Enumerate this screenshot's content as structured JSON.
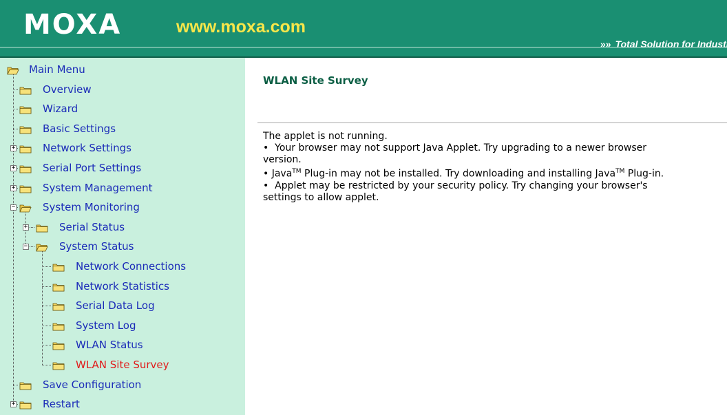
{
  "header": {
    "logo_text": "MOXA",
    "url_text": "www.moxa.com",
    "tagline": "Total Solution for Industrial Device Networking",
    "tagline_arrows": "»»",
    "colors": {
      "bar": "#1a8f72",
      "logo": "#ffffff",
      "url": "#f7e64a"
    }
  },
  "sidebar": {
    "root": {
      "label": "Main Menu",
      "icon": "open-folder-icon"
    },
    "items": [
      {
        "label": "Overview",
        "icon": "folder-icon"
      },
      {
        "label": "Wizard",
        "icon": "folder-icon"
      },
      {
        "label": "Basic Settings",
        "icon": "folder-icon"
      },
      {
        "label": "Network Settings",
        "icon": "folder-icon",
        "expander": "+"
      },
      {
        "label": "Serial Port Settings",
        "icon": "folder-icon",
        "expander": "+"
      },
      {
        "label": "System Management",
        "icon": "folder-icon",
        "expander": "+"
      },
      {
        "label": "System Monitoring",
        "icon": "open-folder-icon",
        "expander": "−"
      },
      {
        "label": "Serial Status",
        "icon": "folder-icon",
        "expander": "+"
      },
      {
        "label": "System Status",
        "icon": "open-folder-icon",
        "expander": "−"
      },
      {
        "label": "Network Connections",
        "icon": "folder-icon"
      },
      {
        "label": "Network Statistics",
        "icon": "folder-icon"
      },
      {
        "label": "Serial Data Log",
        "icon": "folder-icon"
      },
      {
        "label": "System Log",
        "icon": "folder-icon"
      },
      {
        "label": "WLAN Status",
        "icon": "folder-icon"
      },
      {
        "label": "WLAN Site Survey",
        "icon": "folder-icon",
        "active": true
      },
      {
        "label": "Save Configuration",
        "icon": "folder-icon"
      },
      {
        "label": "Restart",
        "icon": "folder-icon",
        "expander": "+"
      }
    ]
  },
  "main": {
    "title": "WLAN Site Survey",
    "message": {
      "line1": "The applet is not running.",
      "bullet": "•",
      "b1a": "Your browser may not support Java Applet. Try upgrading to a newer browser",
      "b1b": "version.",
      "java": "Java",
      "tm": "TM",
      "b2mid": "Plug-in may not be installed. Try downloading and installing Java",
      "b2end": "Plug-in.",
      "b3a": "Applet may be restricted by your security policy. Try changing your browser's",
      "b3b": "settings to allow applet."
    }
  }
}
